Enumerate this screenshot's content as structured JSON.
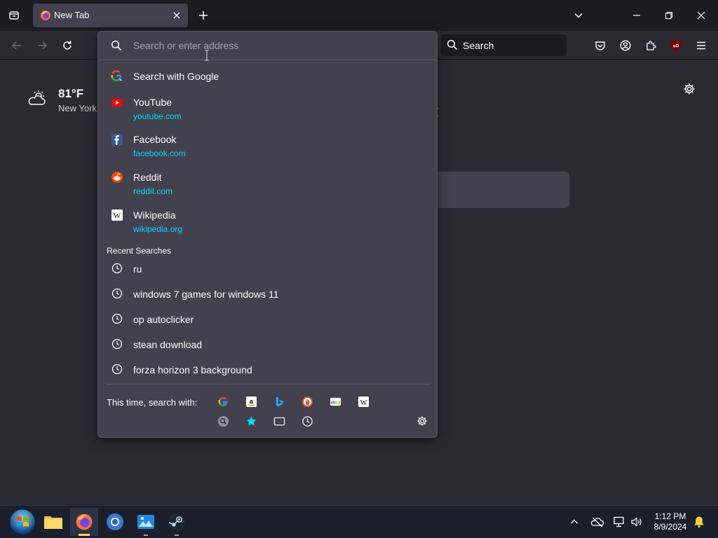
{
  "tabstrip": {
    "active_tab_title": "New Tab"
  },
  "navbar": {
    "search_label": "Search"
  },
  "page": {
    "weather_temp": "81°F",
    "weather_city": "New York"
  },
  "urlbar": {
    "placeholder": "Search or enter address",
    "first_row": "Search with Google",
    "shortcuts": [
      {
        "title": "YouTube",
        "url": "youtube.com",
        "icon": "youtube-icon"
      },
      {
        "title": "Facebook",
        "url": "facebook.com",
        "icon": "facebook-icon"
      },
      {
        "title": "Reddit",
        "url": "reddit.com",
        "icon": "reddit-icon"
      },
      {
        "title": "Wikipedia",
        "url": "wikipedia.org",
        "icon": "wikipedia-icon"
      }
    ],
    "recent_label": "Recent Searches",
    "recent": [
      "ru",
      "windows 7 games for windows 11",
      "op autoclicker",
      "stean download",
      "forza horizon 3 background"
    ],
    "search_with_label": "This time, search with:",
    "engines": [
      "google-icon",
      "amazon-icon",
      "bing-icon",
      "duckduckgo-icon",
      "ebay-icon",
      "wikipedia-icon",
      "search-engine-icon",
      "bookmarks-icon",
      "tabs-icon",
      "history-icon"
    ]
  },
  "taskbar": {
    "time": "1:12 PM",
    "date": "8/9/2024"
  },
  "colors": {
    "accent": "#00ddff",
    "popup_bg": "#42414d",
    "toolbar_bg": "#2b2a33",
    "tabstrip_bg": "#1c1b22"
  }
}
